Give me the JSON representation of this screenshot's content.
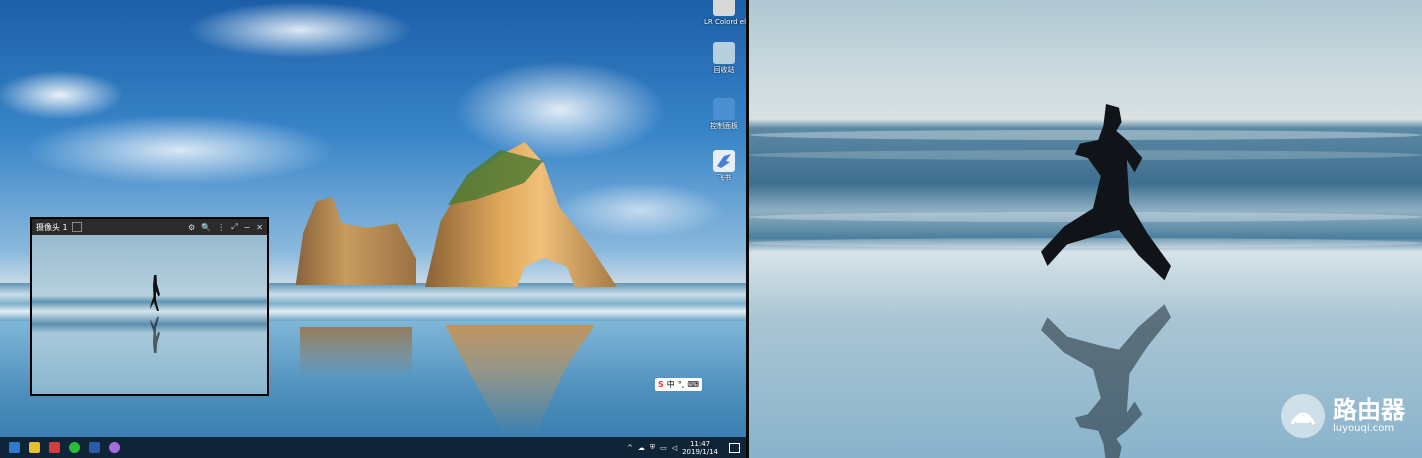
{
  "desktop": {
    "icons": [
      {
        "label": "LR Colord ele...",
        "icon": "file-icon",
        "color": "#d8d8d8"
      },
      {
        "label": "回收站",
        "icon": "recycle-bin-icon",
        "color": "#b8cfe0"
      },
      {
        "label": "控制面板",
        "icon": "control-panel-icon",
        "color": "#4a8fd0"
      },
      {
        "label": "飞书",
        "icon": "app-bird-icon",
        "color": "#e8eef6"
      }
    ],
    "camera_window": {
      "title": "摄像头 1",
      "toolbar": [
        "⚙",
        "🔍",
        "⋮",
        "⤢",
        "−",
        "✕"
      ]
    },
    "ime": {
      "logo": "S",
      "mode": "中",
      "punct": "°,",
      "keyboard": "⌨"
    },
    "taskbar": {
      "apps": [
        {
          "icon": "app-icon-1",
          "color": "#2f7ad1"
        },
        {
          "icon": "app-icon-2",
          "color": "#e7c12d"
        },
        {
          "icon": "app-icon-3",
          "color": "#d23d3d"
        },
        {
          "icon": "wechat-icon",
          "color": "#2dbb3b"
        },
        {
          "icon": "word-icon",
          "color": "#2a5aa8"
        },
        {
          "icon": "app-icon-6",
          "color": "#a46cd6"
        }
      ],
      "tray": [
        "^",
        "☁",
        "⛨",
        "▭",
        "◁"
      ],
      "time": "11:47",
      "date": "2019/1/14"
    }
  },
  "watermark": {
    "name": "路由器",
    "url": "luyouqi.com"
  }
}
